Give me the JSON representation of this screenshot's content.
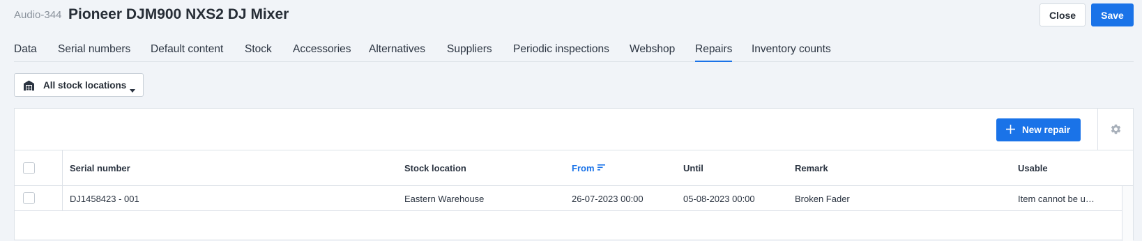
{
  "header": {
    "item_code": "Audio-344",
    "title": "Pioneer DJM900 NXS2 DJ Mixer",
    "close_label": "Close",
    "save_label": "Save"
  },
  "tabs": [
    {
      "label": "Data",
      "active": false
    },
    {
      "label": "Serial numbers",
      "active": false
    },
    {
      "label": "Default content",
      "active": false
    },
    {
      "label": "Stock",
      "active": false
    },
    {
      "label": "Accessories",
      "active": false
    },
    {
      "label": "Alternatives",
      "active": false
    },
    {
      "label": "Suppliers",
      "active": false
    },
    {
      "label": "Periodic inspections",
      "active": false
    },
    {
      "label": "Webshop",
      "active": false
    },
    {
      "label": "Repairs",
      "active": true
    },
    {
      "label": "Inventory counts",
      "active": false
    }
  ],
  "location_filter": {
    "label": "All stock locations",
    "icon": "warehouse-icon"
  },
  "toolbar": {
    "new_repair_label": "New repair",
    "settings_icon": "gear-icon"
  },
  "table": {
    "columns": [
      "Serial number",
      "Stock location",
      "From",
      "Until",
      "Remark",
      "Usable"
    ],
    "sorted_column": "From",
    "rows": [
      {
        "serial_number": "DJ1458423 - 001",
        "stock_location": "Eastern Warehouse",
        "from": "26-07-2023 00:00",
        "until": "05-08-2023 00:00",
        "remark": "Broken Fader",
        "usable": "Item cannot be u…"
      }
    ]
  },
  "colors": {
    "accent": "#1a73e8",
    "background": "#f1f4f8",
    "text": "#2b3441",
    "muted": "#8a929c"
  }
}
